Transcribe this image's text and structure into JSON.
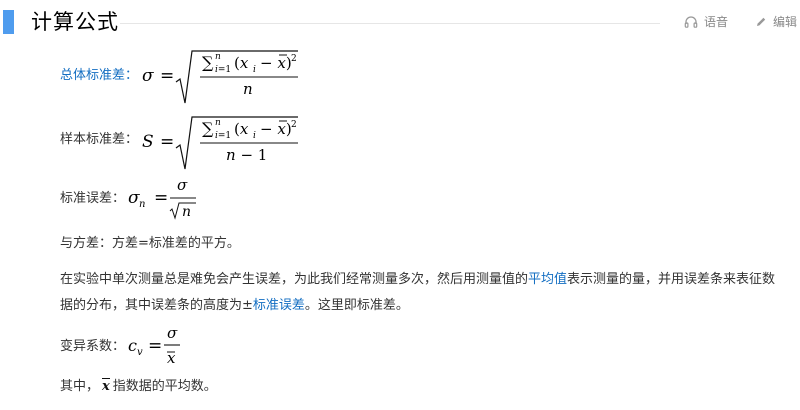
{
  "header": {
    "title": "计算公式",
    "voice_label": "语音",
    "edit_label": "编辑"
  },
  "formulas": {
    "population_std_label": "总体标准差：",
    "sample_std_label": "样本标准差：",
    "std_error_label": "标准误差：",
    "cv_label": "变异系数："
  },
  "variance_note": "与方差：方差=标准差的平方。",
  "paragraph": {
    "part1": "在实验中单次测量总是难免会产生误差，为此我们经常测量多次，然后用测量值的",
    "link1": "平均值",
    "part2": "表示测量的量，并用误差条来表征数据的分布，其中误差条的高度为±",
    "link2": "标准误差",
    "part3": "。这里即标准差。"
  },
  "mean_note": {
    "prefix": "其中，",
    "suffix": "指数据的平均数。"
  }
}
